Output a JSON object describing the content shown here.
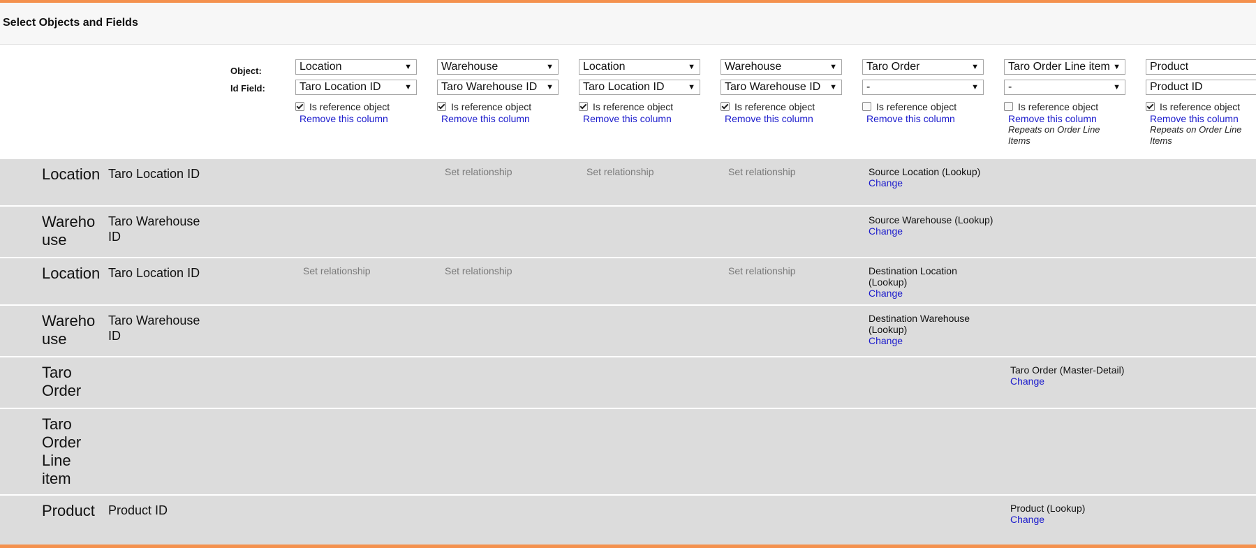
{
  "header": {
    "title": "Select Objects and Fields"
  },
  "controls": {
    "object_label": "Object:",
    "id_field_label": "Id Field:",
    "ref_label": "Is reference object",
    "remove_label": "Remove this column",
    "repeats_label": "Repeats on Order Line Items",
    "columns": [
      {
        "object": "Location",
        "id_field": "Taro Location ID",
        "is_reference": true
      },
      {
        "object": "Warehouse",
        "id_field": "Taro Warehouse ID",
        "is_reference": true
      },
      {
        "object": "Location",
        "id_field": "Taro Location ID",
        "is_reference": true
      },
      {
        "object": "Warehouse",
        "id_field": "Taro Warehouse ID",
        "is_reference": true
      },
      {
        "object": "Taro Order",
        "id_field": "-",
        "is_reference": false
      },
      {
        "object": "Taro Order Line item",
        "id_field": "-",
        "is_reference": false,
        "repeats": true
      },
      {
        "object": "Product",
        "id_field": "Product ID",
        "is_reference": true,
        "repeats": true
      }
    ]
  },
  "set_relationship_label": "Set relationship",
  "change_label": "Change",
  "rows": [
    {
      "name": "Location",
      "id": "Taro Location ID"
    },
    {
      "name": "Wareho use",
      "id": "Taro Warehouse ID"
    },
    {
      "name": "Location",
      "id": "Taro Location ID"
    },
    {
      "name": "Wareho use",
      "id": "Taro Warehouse ID"
    },
    {
      "name": "Taro Order",
      "id": ""
    },
    {
      "name": "Taro Order Line item",
      "id": ""
    },
    {
      "name": "Product",
      "id": "Product ID"
    }
  ],
  "relationships": {
    "r0c4": "Source Location (Lookup)",
    "r1c4": "Source Warehouse (Lookup)",
    "r2c4": "Destination Location (Lookup)",
    "r3c4": "Destination Warehouse (Lookup)",
    "r4c5": "Taro Order (Master-Detail)",
    "r6c5": "Product (Lookup)"
  },
  "colors": {
    "accent": "#f4914e",
    "link": "#1a1acc",
    "row_bg": "#dcdcdc"
  }
}
